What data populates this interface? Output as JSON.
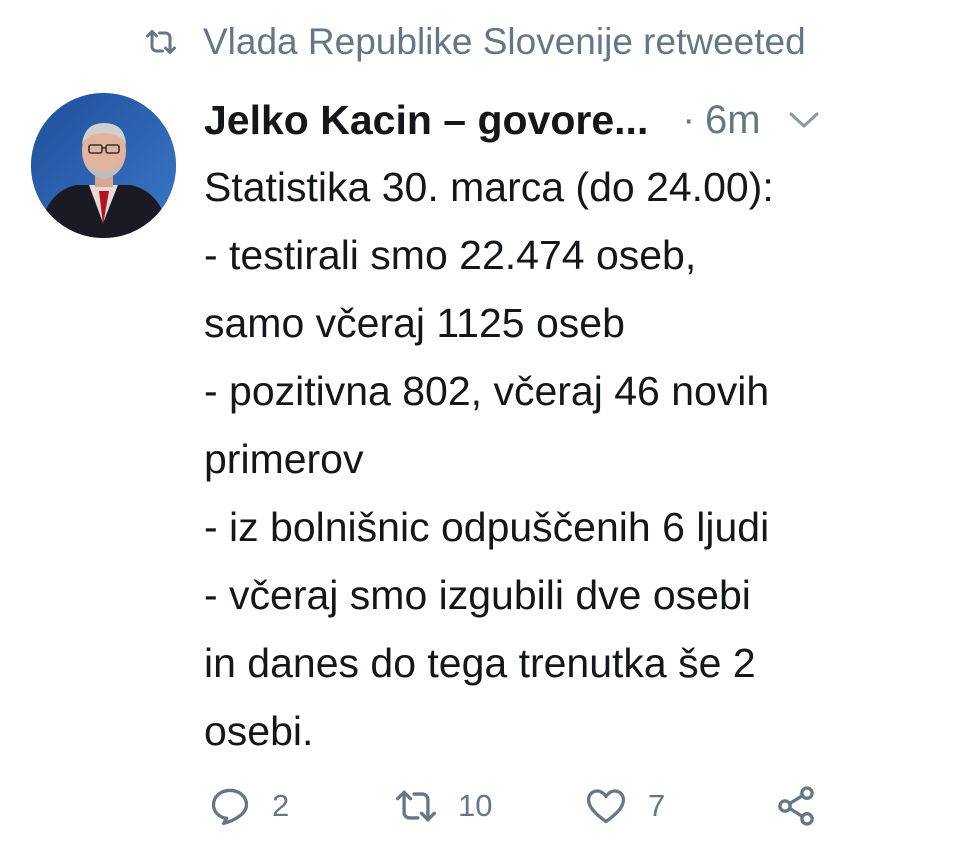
{
  "retweet_context": {
    "icon": "retweet-icon",
    "text": "Vlada Republike Slovenije retweeted"
  },
  "tweet": {
    "author_name": "Jelko Kacin – govore...",
    "separator": "·",
    "time": "6m",
    "lines": [
      "Statistika 30. marca (do 24.00):",
      "- testirali smo 22.474 oseb,",
      "samo včeraj 1125 oseb",
      "- pozitivna 802, včeraj 46 novih",
      "primerov",
      "- iz bolnišnic odpuščenih 6 ljudi",
      "- včeraj smo izgubili dve osebi",
      "in danes do tega trenutka še 2",
      "osebi."
    ]
  },
  "actions": {
    "reply_count": "2",
    "retweet_count": "10",
    "like_count": "7"
  },
  "colors": {
    "text": "#14171a",
    "muted": "#657786",
    "avatar_bg": "#2a5ca8"
  }
}
